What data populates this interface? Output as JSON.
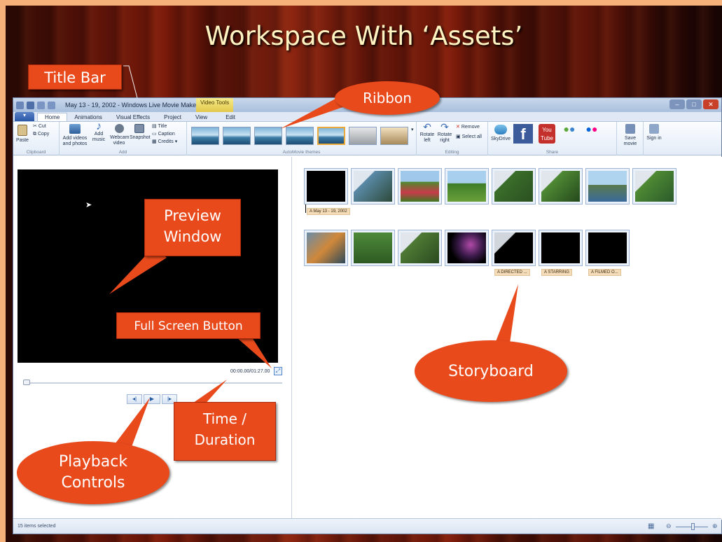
{
  "slide": {
    "title": "Workspace With ‘Assets’"
  },
  "window": {
    "title": "May 13 - 19, 2002 - Windows Live Movie Maker",
    "contextual_tab": "Video Tools",
    "tabs": [
      "Home",
      "Animations",
      "Visual Effects",
      "Project",
      "View",
      "Edit"
    ],
    "active_tab": "Home"
  },
  "ribbon": {
    "clipboard": {
      "label": "Clipboard",
      "paste": "Paste",
      "cut": "Cut",
      "copy": "Copy"
    },
    "add": {
      "label": "Add",
      "add_videos": "Add videos and photos",
      "add_music": "Add music",
      "webcam": "Webcam video",
      "snapshot": "Snapshot",
      "title": "Title",
      "caption": "Caption",
      "credits": "Credits"
    },
    "themes": {
      "label": "AutoMovie themes"
    },
    "editing": {
      "label": "Editing",
      "rotate_left": "Rotate left",
      "rotate_right": "Rotate right",
      "remove": "Remove",
      "select_all": "Select all"
    },
    "share": {
      "label": "Share",
      "skydrive": "SkyDrive",
      "save_movie": "Save movie",
      "sign_in": "Sign in"
    }
  },
  "preview": {
    "time": "00:00.00/01:27.00"
  },
  "storyboard": {
    "row1_caption": "May 13 - 19, 2002",
    "row2_captions": [
      "DIRECTED ...",
      "STARRING",
      "FILMED O..."
    ]
  },
  "statusbar": {
    "text": "15 items selected"
  },
  "callouts": {
    "title_bar": "Title Bar",
    "ribbon": "Ribbon",
    "preview_window": [
      "Preview",
      "Window"
    ],
    "full_screen": "Full Screen Button",
    "storyboard": "Storyboard",
    "time_duration": [
      "Time /",
      "Duration"
    ],
    "playback": [
      "Playback",
      "Controls"
    ]
  },
  "colors": {
    "callout": "#e84a1c",
    "slide_title": "#fff3c2",
    "background_border": "#f6b07a"
  }
}
